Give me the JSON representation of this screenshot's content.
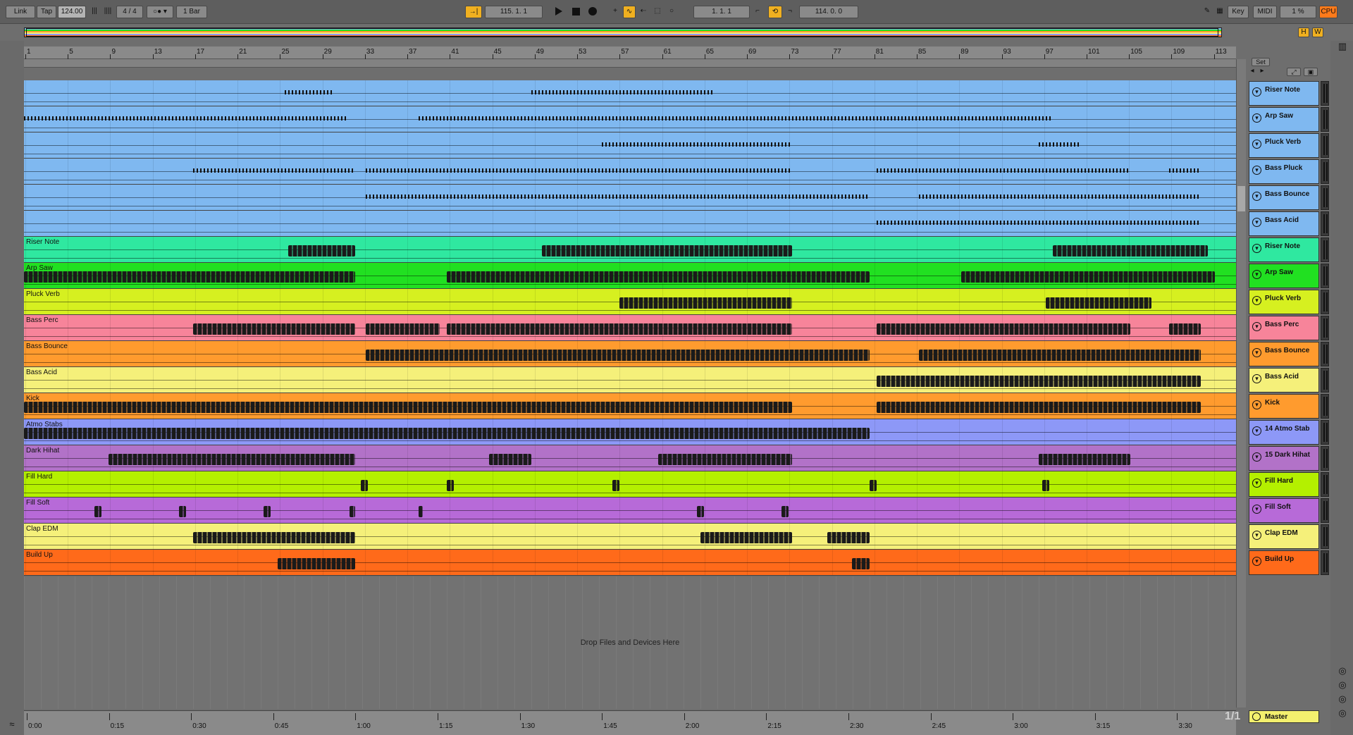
{
  "transport": {
    "link": "Link",
    "tap": "Tap",
    "tempo": "124.00",
    "signature": "4 / 4",
    "quantize": "1 Bar",
    "arrangement_position": "115.  1.  1",
    "loop_start": "1.  1.  1",
    "loop_length": "114.  0.  0",
    "key_label": "Key",
    "midi_label": "MIDI",
    "cpu_value": "1 %",
    "cpu_label": "CPU"
  },
  "overview": {
    "h_button": "H",
    "w_button": "W"
  },
  "set_button": "Set",
  "bar_numbers": [
    "1",
    "5",
    "9",
    "13",
    "17",
    "21",
    "25",
    "29",
    "33",
    "37",
    "41",
    "45",
    "49",
    "53",
    "57",
    "61",
    "65",
    "69",
    "73",
    "77",
    "81",
    "85",
    "89",
    "93",
    "97",
    "101",
    "105",
    "109",
    "113"
  ],
  "time_labels": [
    "0:00",
    "0:15",
    "0:30",
    "0:45",
    "1:00",
    "1:15",
    "1:30",
    "1:45",
    "2:00",
    "2:15",
    "2:30",
    "2:45",
    "3:00",
    "3:15",
    "3:30"
  ],
  "drop_zone_text": "Drop Files and Devices Here",
  "page_indicator": "1/1",
  "colors": {
    "midi_blue": "#7fb8f0",
    "riser_note": "#2fe8a0",
    "arp_saw": "#21e021",
    "pluck_verb": "#d6f020",
    "bass_perc": "#f7849a",
    "bass_bounce": "#ff9b2e",
    "bass_acid": "#f5f07a",
    "kick": "#ff9b2e",
    "atmo_stabs": "#8d98f7",
    "dark_hihat": "#b272c8",
    "fill_hard": "#b4f000",
    "fill_soft": "#b76ad8",
    "clap_edm": "#f5f07a",
    "build_up": "#ff6a1a",
    "master": "#f3f06e"
  },
  "tracks": [
    {
      "label": "",
      "header": "Riser Note",
      "color": "#7fb8f0",
      "header_color": "#7fb8f0"
    },
    {
      "label": "",
      "header": "Arp Saw",
      "color": "#7fb8f0",
      "header_color": "#7fb8f0"
    },
    {
      "label": "",
      "header": "Pluck Verb",
      "color": "#7fb8f0",
      "header_color": "#7fb8f0"
    },
    {
      "label": "",
      "header": "Bass Pluck",
      "color": "#7fb8f0",
      "header_color": "#7fb8f0"
    },
    {
      "label": "",
      "header": "Bass Bounce",
      "color": "#7fb8f0",
      "header_color": "#7fb8f0"
    },
    {
      "label": "",
      "header": "Bass Acid",
      "color": "#7fb8f0",
      "header_color": "#7fb8f0"
    },
    {
      "label": "Riser Note",
      "header": "Riser Note",
      "color": "#2fe8a0",
      "header_color": "#2fe8a0"
    },
    {
      "label": "Arp Saw",
      "header": "Arp Saw",
      "color": "#21e021",
      "header_color": "#21e021"
    },
    {
      "label": "Pluck Verb",
      "header": "Pluck Verb",
      "color": "#d6f020",
      "header_color": "#d6f020"
    },
    {
      "label": "Bass Perc",
      "header": "Bass Perc",
      "color": "#f7849a",
      "header_color": "#f7849a"
    },
    {
      "label": "Bass Bounce",
      "header": "Bass Bounce",
      "color": "#ff9b2e",
      "header_color": "#ff9b2e"
    },
    {
      "label": "Bass Acid",
      "header": "Bass Acid",
      "color": "#f5f07a",
      "header_color": "#f5f07a"
    },
    {
      "label": "Kick",
      "header": "Kick",
      "color": "#ff9b2e",
      "header_color": "#ff9b2e"
    },
    {
      "label": "Atmo Stabs",
      "header": "14 Atmo Stab",
      "color": "#8d98f7",
      "header_color": "#8d98f7"
    },
    {
      "label": "Dark Hihat",
      "header": "15 Dark Hihat",
      "color": "#b272c8",
      "header_color": "#b272c8"
    },
    {
      "label": "Fill Hard",
      "header": "Fill Hard",
      "color": "#b4f000",
      "header_color": "#b4f000"
    },
    {
      "label": "Fill Soft",
      "header": "Fill Soft",
      "color": "#b76ad8",
      "header_color": "#b76ad8"
    },
    {
      "label": "Clap EDM",
      "header": "Clap EDM",
      "color": "#f5f07a",
      "header_color": "#f5f07a"
    },
    {
      "label": "Build Up",
      "header": "Build Up",
      "color": "#ff6a1a",
      "header_color": "#ff6a1a"
    }
  ],
  "master": {
    "header": "Master"
  }
}
